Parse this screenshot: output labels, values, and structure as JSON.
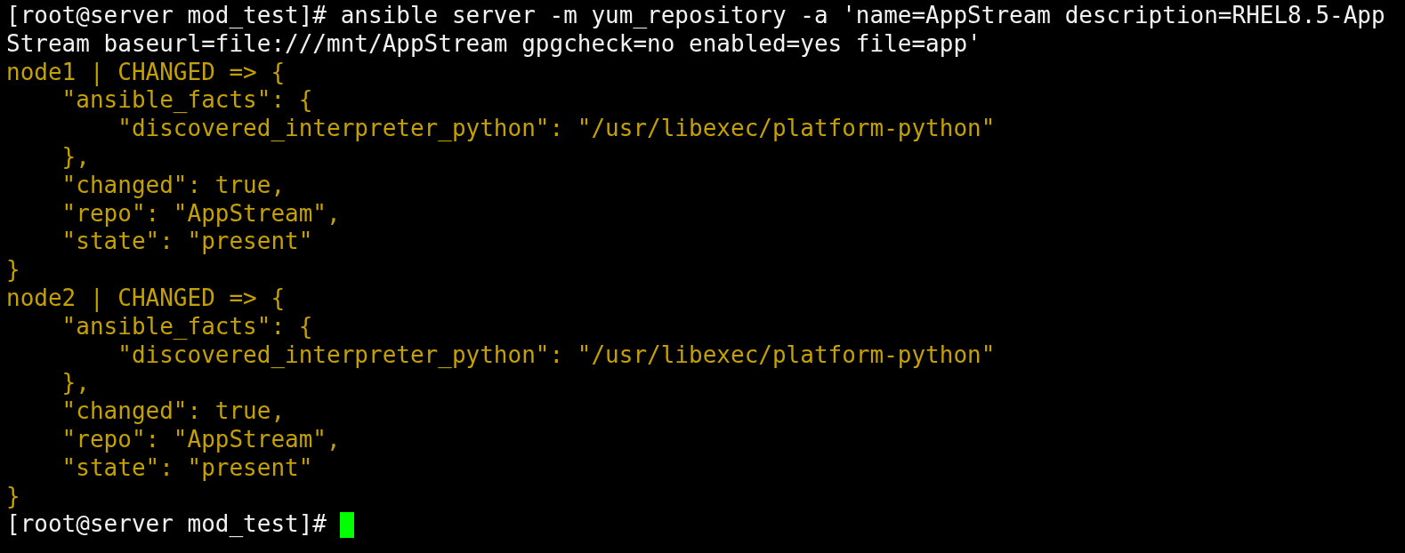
{
  "terminal": {
    "lines": [
      {
        "kind": "command",
        "text": "[root@server mod_test]# ansible server -m yum_repository -a 'name=AppStream description=RHEL8.5-AppStream baseurl=file:///mnt/AppStream gpgcheck=no enabled=yes file=app'"
      },
      {
        "kind": "output",
        "text": "node1 | CHANGED => {"
      },
      {
        "kind": "output",
        "text": "    \"ansible_facts\": {"
      },
      {
        "kind": "output",
        "text": "        \"discovered_interpreter_python\": \"/usr/libexec/platform-python\""
      },
      {
        "kind": "output",
        "text": "    },"
      },
      {
        "kind": "output",
        "text": "    \"changed\": true,"
      },
      {
        "kind": "output",
        "text": "    \"repo\": \"AppStream\","
      },
      {
        "kind": "output",
        "text": "    \"state\": \"present\""
      },
      {
        "kind": "output",
        "text": "}"
      },
      {
        "kind": "output",
        "text": "node2 | CHANGED => {"
      },
      {
        "kind": "output",
        "text": "    \"ansible_facts\": {"
      },
      {
        "kind": "output",
        "text": "        \"discovered_interpreter_python\": \"/usr/libexec/platform-python\""
      },
      {
        "kind": "output",
        "text": "    },"
      },
      {
        "kind": "output",
        "text": "    \"changed\": true,"
      },
      {
        "kind": "output",
        "text": "    \"repo\": \"AppStream\","
      },
      {
        "kind": "output",
        "text": "    \"state\": \"present\""
      },
      {
        "kind": "output",
        "text": "}"
      },
      {
        "kind": "prompt",
        "text": "[root@server mod_test]#"
      }
    ]
  }
}
